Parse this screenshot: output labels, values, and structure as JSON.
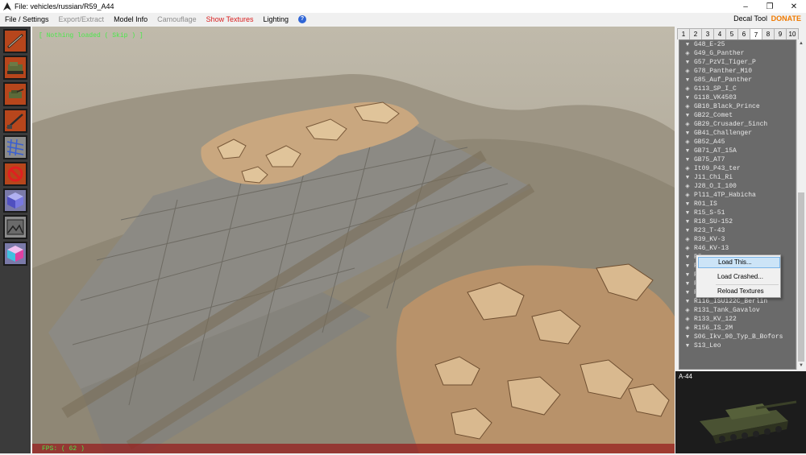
{
  "window": {
    "title": "File: vehicles/russian/R59_A44",
    "controls": [
      "–",
      "❐",
      "✕"
    ]
  },
  "menu": {
    "items": [
      {
        "label": "File / Settings",
        "state": "normal"
      },
      {
        "label": "Export/Extract",
        "state": "disabled"
      },
      {
        "label": "Model Info",
        "state": "normal"
      },
      {
        "label": "Camouflage",
        "state": "disabled"
      },
      {
        "label": "Show Textures",
        "state": "red"
      },
      {
        "label": "Lighting",
        "state": "normal"
      }
    ],
    "help": "?",
    "decal_tool": "Decal Tool",
    "donate": "DONATE"
  },
  "toolbar": {
    "buttons": [
      {
        "name": "gun-barrel-icon",
        "bg": "#b7461c"
      },
      {
        "name": "tank-hull-icon",
        "bg": "#b7461c"
      },
      {
        "name": "tank-turret-icon",
        "bg": "#b7461c"
      },
      {
        "name": "gun-icon",
        "bg": "#b7461c"
      },
      {
        "name": "grid-icon",
        "bg": "#8b8b8b"
      },
      {
        "name": "no-entry-icon",
        "bg": "#b7461c"
      },
      {
        "name": "cube-icon",
        "bg": "#7a7aa8"
      },
      {
        "name": "image-icon",
        "bg": "#8b8b8b"
      },
      {
        "name": "color-cube-icon",
        "bg": "#7a7aa8"
      }
    ]
  },
  "viewport": {
    "status_text": "[ Nothing loaded ( Skip ) ]",
    "fps_text": "FPS: ( 62 )"
  },
  "right_panel": {
    "tabs": [
      "1",
      "2",
      "3",
      "4",
      "5",
      "6",
      "7",
      "8",
      "9",
      "10"
    ],
    "active_tab": "7",
    "vehicles": [
      {
        "icon": "down",
        "name": "G48_E-25"
      },
      {
        "icon": "diamond",
        "name": "G49_G_Panther"
      },
      {
        "icon": "down",
        "name": "G57_PzVI_Tiger_P"
      },
      {
        "icon": "diamond",
        "name": "G78_Panther_M10"
      },
      {
        "icon": "down",
        "name": "G85_Auf_Panther"
      },
      {
        "icon": "diamond",
        "name": "G113_SP_I_C"
      },
      {
        "icon": "down",
        "name": "G118_VK4503"
      },
      {
        "icon": "diamond",
        "name": "GB10_Black_Prince"
      },
      {
        "icon": "down",
        "name": "GB22_Comet"
      },
      {
        "icon": "diamond",
        "name": "GB29_Crusader_5inch"
      },
      {
        "icon": "down",
        "name": "GB41_Challenger"
      },
      {
        "icon": "diamond",
        "name": "GB52_A45"
      },
      {
        "icon": "down",
        "name": "GB71_AT_15A"
      },
      {
        "icon": "down",
        "name": "GB75_AT7"
      },
      {
        "icon": "diamond",
        "name": "It09_P43_ter"
      },
      {
        "icon": "down",
        "name": "J11_Chi_Ri"
      },
      {
        "icon": "diamond",
        "name": "J28_O_I_100"
      },
      {
        "icon": "diamond",
        "name": "Pl11_4TP_Habicha"
      },
      {
        "icon": "down",
        "name": "R01_IS"
      },
      {
        "icon": "down",
        "name": "R15_S-51"
      },
      {
        "icon": "down",
        "name": "R18_SU-152"
      },
      {
        "icon": "down",
        "name": "R23_T-43"
      },
      {
        "icon": "diamond",
        "name": "R39_KV-3"
      },
      {
        "icon": "diamond",
        "name": "R46_KV-13"
      },
      {
        "icon": "down",
        "name": "R5"
      },
      {
        "icon": "down",
        "name": "R"
      },
      {
        "icon": "down",
        "name": "R"
      },
      {
        "icon": "down",
        "name": "R"
      },
      {
        "icon": "down",
        "name": "R"
      },
      {
        "icon": "down",
        "name": "R116_ISU122C_Berlin"
      },
      {
        "icon": "diamond",
        "name": "R131_Tank_Gavalov"
      },
      {
        "icon": "diamond",
        "name": "R133_KV_122"
      },
      {
        "icon": "diamond",
        "name": "R156_IS_2M"
      },
      {
        "icon": "down",
        "name": "S06_Ikv_90_Typ_B_Bofors"
      },
      {
        "icon": "down",
        "name": "S13_Leo"
      }
    ],
    "preview_label": "A-44"
  },
  "context_menu": {
    "items": [
      {
        "label": "Load This...",
        "highlighted": true
      },
      {
        "label": "Load Crashed...",
        "highlighted": false
      },
      {
        "label": "Reload Textures",
        "highlighted": false
      }
    ]
  }
}
